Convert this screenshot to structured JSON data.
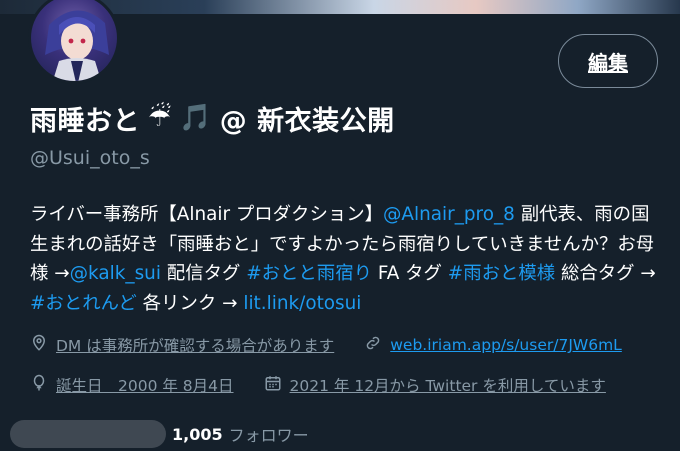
{
  "header": {
    "edit_button": "編集"
  },
  "profile": {
    "name": "雨睡おと",
    "emoji_umbrella": "☔",
    "emoji_note": "🎵",
    "name_suffix": "@ 新衣装公開",
    "handle": "@Usui_oto_s"
  },
  "bio": {
    "t1": "ライバー事務所【Alnair プロダクション】",
    "l1": "@Alnair_pro_8",
    "t2": " 副代表、雨の国生まれの話好き「雨睡おと」ですよかったら雨宿りしていきませんか？お母様 →",
    "l2": "@kalk_sui",
    "t3": " 配信タグ ",
    "l3": "#おとと雨宿り",
    "t4": " FA タグ ",
    "l4": "#雨おと模様",
    "t5": " 総合タグ → ",
    "l5": "#おとれんど",
    "t6": " 各リンク → ",
    "l6": "lit.link/otosui"
  },
  "meta": {
    "location": "DM は事務所が確認する場合があります",
    "website": "web.iriam.app/s/user/7JW6mL",
    "birthday": "誕生日　2000 年 8月4日",
    "joined": "2021 年 12月から Twitter を利用しています"
  },
  "stats": {
    "followers_count": "1,005",
    "followers_label": "フォロワー"
  }
}
